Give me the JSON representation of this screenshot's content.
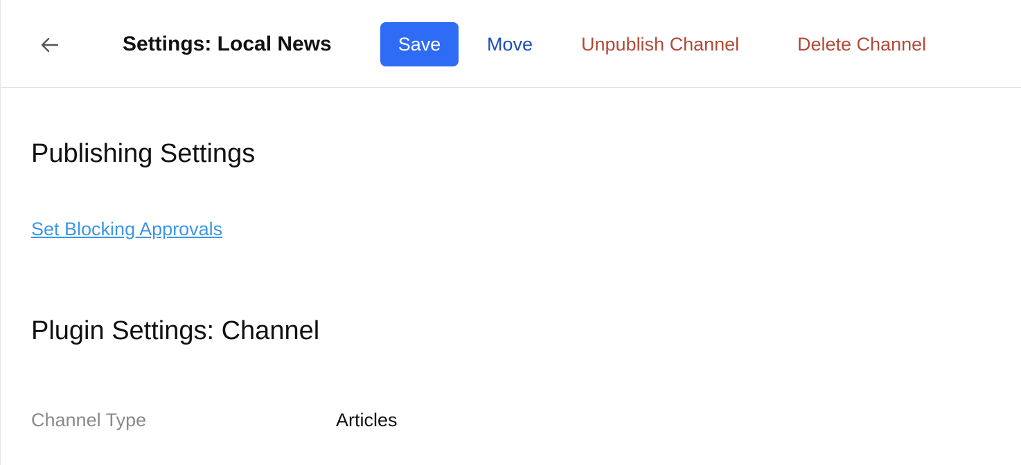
{
  "header": {
    "back_icon": "arrow-left-icon",
    "title": "Settings: Local News",
    "save_label": "Save",
    "move_label": "Move",
    "unpublish_label": "Unpublish Channel",
    "delete_label": "Delete Channel"
  },
  "publishing": {
    "title": "Publishing Settings",
    "approvals_link": "Set Blocking Approvals"
  },
  "plugin": {
    "title": "Plugin Settings: Channel",
    "fields": [
      {
        "label": "Channel Type",
        "value": "Articles"
      }
    ]
  },
  "colors": {
    "primary": "#2f6cf6",
    "move": "#1d4fb8",
    "danger": "#b24a37",
    "link": "#3d96e4",
    "muted": "#8a8a8a"
  }
}
